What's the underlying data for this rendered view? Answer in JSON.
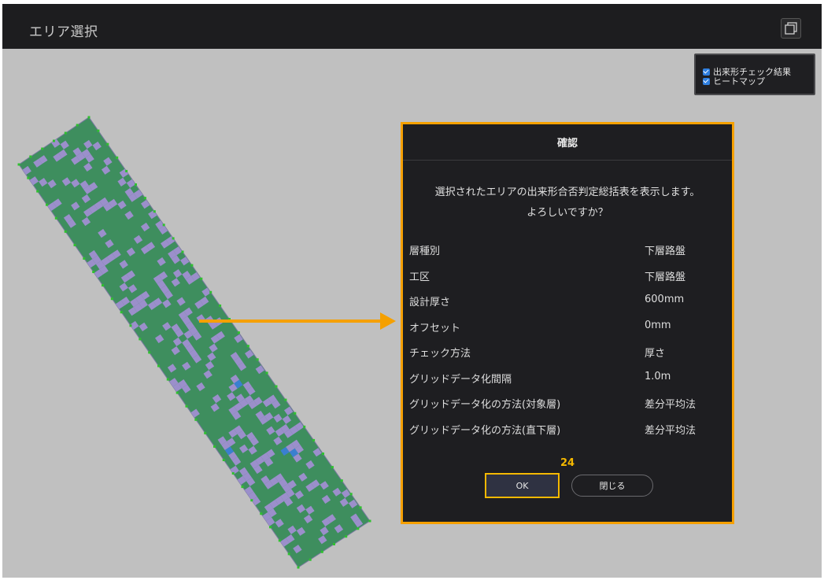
{
  "window": {
    "title": "エリア選択"
  },
  "layers": {
    "items": [
      {
        "label": "出来形チェック結果",
        "checked": true
      },
      {
        "label": "ヒートマップ",
        "checked": true
      }
    ]
  },
  "dialog": {
    "title": "確認",
    "message_line1": "選択されたエリアの出来形合否判定総括表を表示します。",
    "message_line2": "よろしいですか？",
    "rows": [
      {
        "label": "層種別",
        "value": "下層路盤"
      },
      {
        "label": "工区",
        "value": "下層路盤"
      },
      {
        "label": "設計厚さ",
        "value": "600mm"
      },
      {
        "label": "オフセット",
        "value": "0mm"
      },
      {
        "label": "チェック方法",
        "value": "厚さ"
      },
      {
        "label": "グリッドデータ化間隔",
        "value": "1.0m"
      },
      {
        "label": "グリッドデータ化の方法(対象層)",
        "value": "差分平均法"
      },
      {
        "label": "グリッドデータ化の方法(直下層)",
        "value": "差分平均法"
      }
    ],
    "counter": "24",
    "ok_label": "OK",
    "close_label": "閉じる"
  },
  "colors": {
    "background": "#c0c0c0",
    "topbar": "#1d1d1f",
    "heatmap_green": "#3e8e5e",
    "heatmap_purple": "#9b8fcb",
    "heatmap_blue": "#3a7fd0",
    "highlight": "#f5a000"
  }
}
